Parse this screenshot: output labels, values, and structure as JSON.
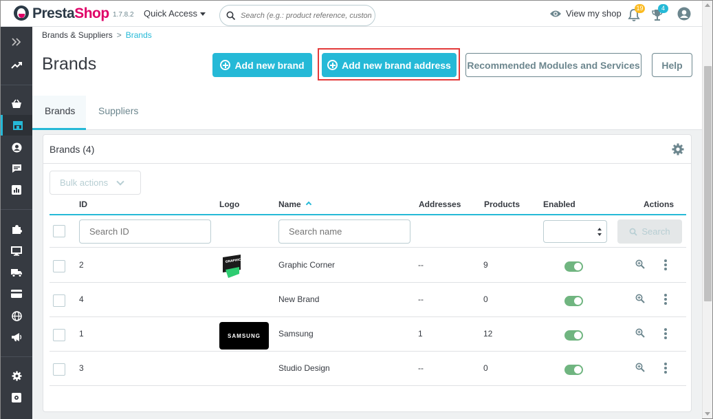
{
  "header": {
    "brand_main": "Presta",
    "brand_accent": "Shop",
    "version": "1.7.8.2",
    "quick_access": "Quick Access",
    "search_placeholder": "Search (e.g.: product reference, custon",
    "view_shop": "View my shop",
    "notifications_orders": "19",
    "notifications_customers": "4"
  },
  "sidebar": {
    "icons": [
      "expand-icon",
      "stats-trend-icon",
      "orders-basket-icon",
      "catalog-store-icon",
      "customers-icon",
      "messages-icon",
      "stats-icon",
      "modules-puzzle-icon",
      "design-monitor-icon",
      "shipping-truck-icon",
      "payment-card-icon",
      "international-globe-icon",
      "marketing-megaphone-icon",
      "settings-gear-icon",
      "advanced-settings-icon"
    ]
  },
  "breadcrumb": {
    "parent": "Brands & Suppliers",
    "separator": ">",
    "current": "Brands"
  },
  "page": {
    "title": "Brands",
    "add_brand": "Add new brand",
    "add_brand_address": "Add new brand address",
    "recommended": "Recommended Modules and Services",
    "help": "Help"
  },
  "tabs": [
    {
      "label": "Brands",
      "active": true
    },
    {
      "label": "Suppliers",
      "active": false
    }
  ],
  "grid": {
    "title": "Brands (4)",
    "bulk_actions": "Bulk actions",
    "columns": {
      "id": "ID",
      "logo": "Logo",
      "name": "Name",
      "addresses": "Addresses",
      "products": "Products",
      "enabled": "Enabled",
      "actions": "Actions"
    },
    "filters": {
      "id_placeholder": "Search ID",
      "name_placeholder": "Search name",
      "search_button": "Search"
    },
    "rows": [
      {
        "id": "2",
        "logo": "graphic-corner",
        "logo_text": "GRAPHIC CORNER",
        "name": "Graphic Corner",
        "addresses": "--",
        "products": "9",
        "enabled": true
      },
      {
        "id": "4",
        "logo": "",
        "logo_text": "",
        "name": "New Brand",
        "addresses": "--",
        "products": "0",
        "enabled": true
      },
      {
        "id": "1",
        "logo": "samsung",
        "logo_text": "SAMSUNG",
        "name": "Samsung",
        "addresses": "1",
        "products": "12",
        "enabled": true
      },
      {
        "id": "3",
        "logo": "",
        "logo_text": "",
        "name": "Studio Design",
        "addresses": "--",
        "products": "0",
        "enabled": true
      }
    ]
  },
  "colors": {
    "primary": "#25b9d7",
    "sidebar": "#363a41",
    "brand_pink": "#df0067",
    "toggle_on": "#70b580",
    "highlight": "#e33a3a",
    "badge_orange": "#fbbb22",
    "badge_blue": "#25b9d7"
  }
}
